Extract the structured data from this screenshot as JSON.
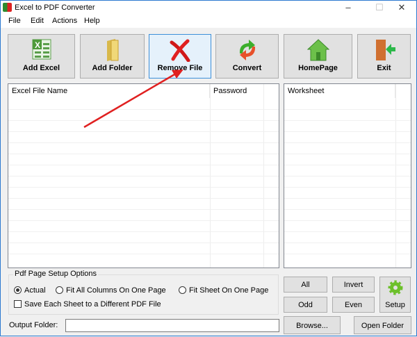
{
  "window": {
    "title": "Excel to PDF Converter"
  },
  "menu": [
    "File",
    "Edit",
    "Actions",
    "Help"
  ],
  "toolbar": [
    {
      "label": "Add Excel",
      "icon": "excel-icon"
    },
    {
      "label": "Add Folder",
      "icon": "folder-icon"
    },
    {
      "label": "Remove File",
      "icon": "remove-x-icon"
    },
    {
      "label": "Convert",
      "icon": "convert-arrows-icon"
    },
    {
      "label": "HomePage",
      "icon": "home-icon"
    },
    {
      "label": "Exit",
      "icon": "exit-door-icon"
    }
  ],
  "file_list": {
    "columns": [
      "Excel File Name",
      "Password"
    ]
  },
  "worksheet_list": {
    "columns": [
      "Worksheet"
    ]
  },
  "options": {
    "title": "Pdf Page Setup Options",
    "radios": [
      "Actual",
      "Fit All Columns On One Page",
      "Fit Sheet On One Page"
    ],
    "selected": "Actual",
    "checkbox": "Save Each Sheet to a Different PDF File",
    "checkbox_checked": false
  },
  "sheet_buttons": {
    "all": "All",
    "invert": "Invert",
    "odd": "Odd",
    "even": "Even",
    "setup": "Setup"
  },
  "output": {
    "label": "Output Folder:",
    "value": "",
    "browse": "Browse...",
    "open": "Open Folder"
  },
  "colors": {
    "accent": "#3c8fd8",
    "arrow": "#e02020"
  }
}
